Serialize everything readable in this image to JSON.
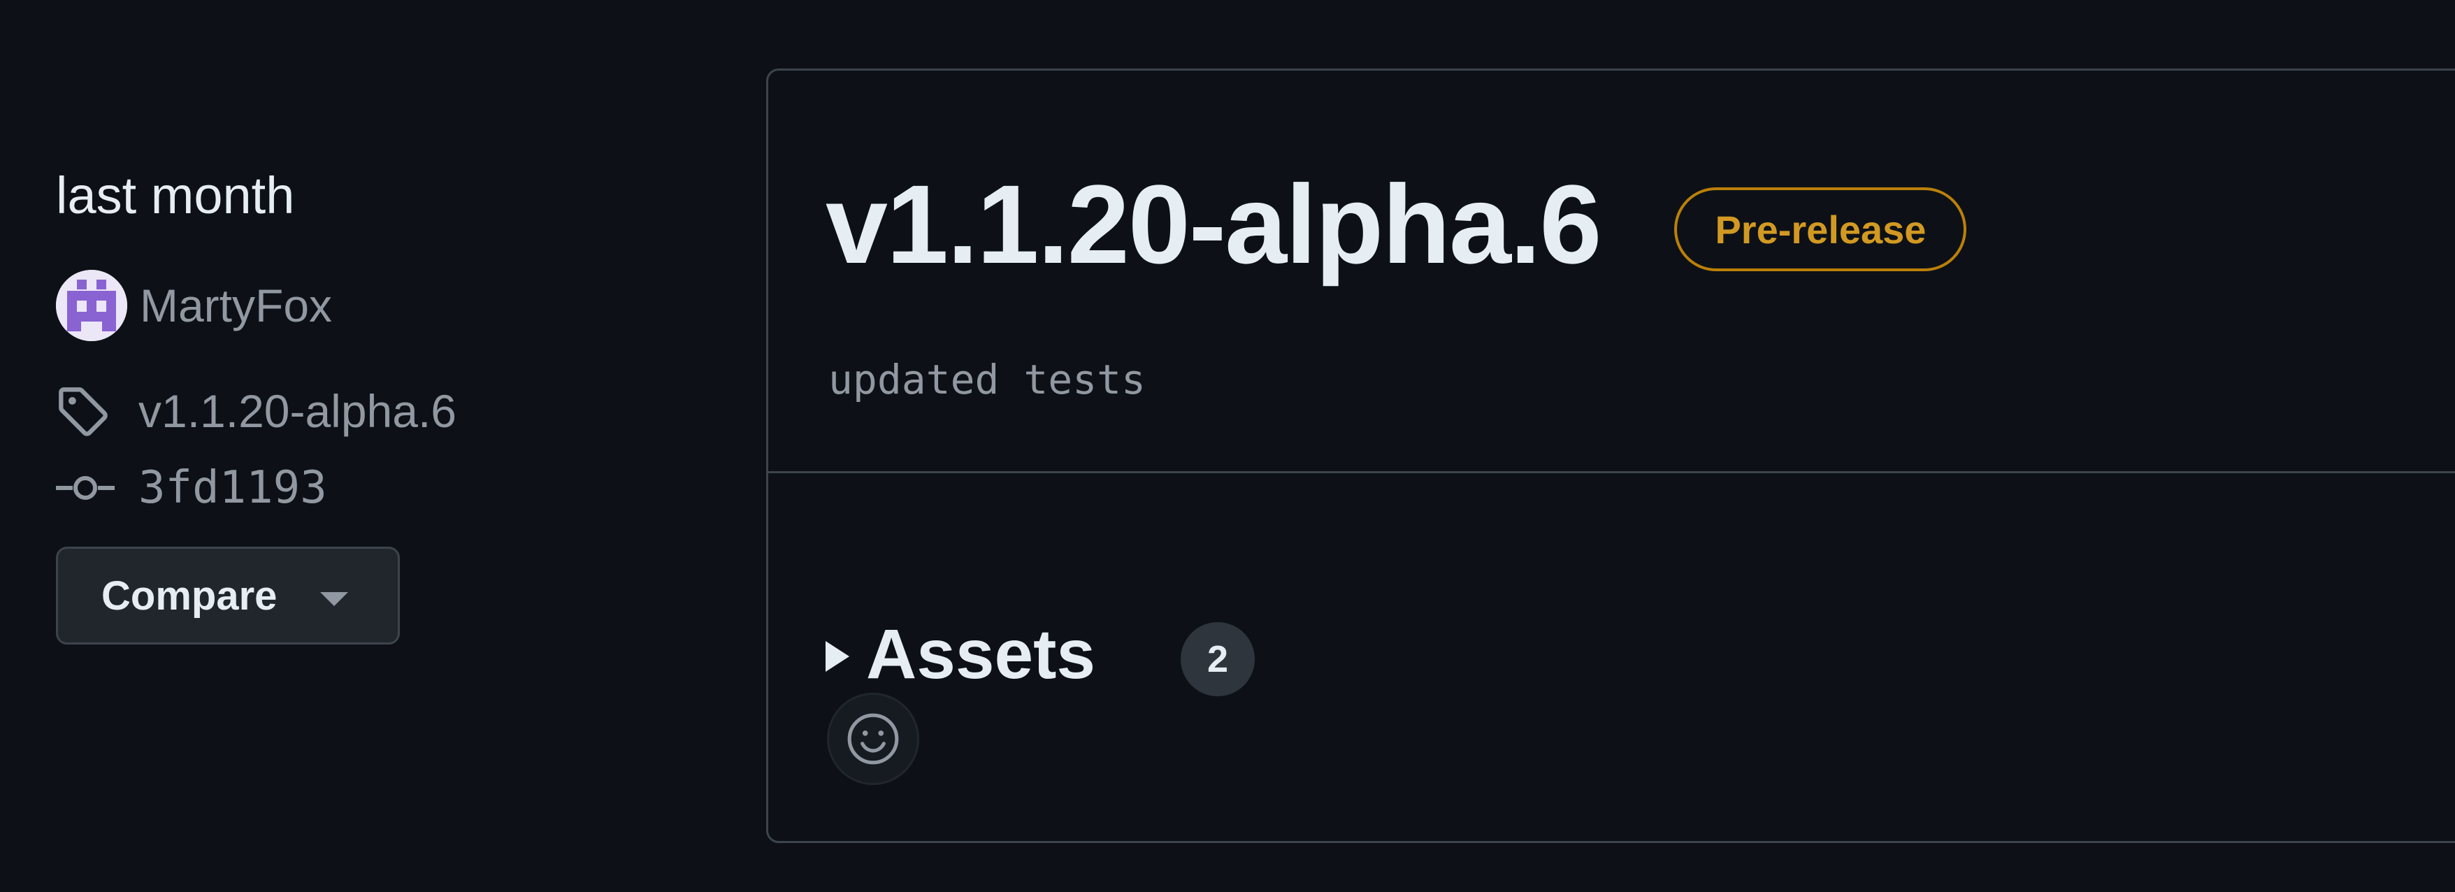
{
  "sidebar": {
    "time": "last month",
    "author": "MartyFox",
    "avatar_icon": "identicon-avatar",
    "tag": "v1.1.20-alpha.6",
    "tag_icon": "tag-icon",
    "commit": "3fd1193",
    "commit_icon": "git-commit-icon",
    "compare_label": "Compare"
  },
  "release": {
    "title": "v1.1.20-alpha.6",
    "badge": "Pre-release",
    "notes": "updated tests",
    "assets_label": "Assets",
    "assets_count": "2",
    "reaction_icon": "smiley-icon"
  },
  "colors": {
    "background": "#0d1117",
    "border": "#3d444d",
    "text_primary": "#e6edf3",
    "text_muted": "#9198a1",
    "badge_prerelease": "#d29922"
  }
}
